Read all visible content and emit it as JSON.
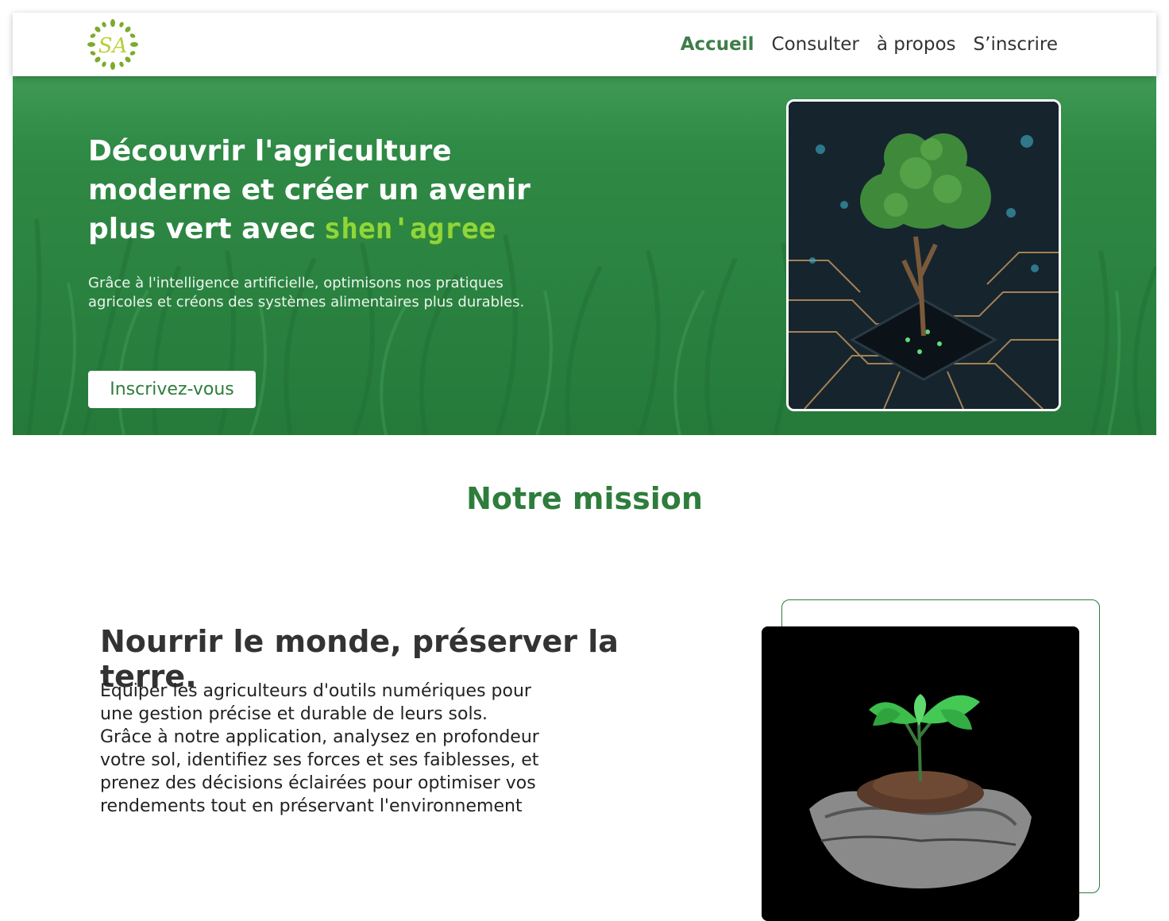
{
  "header": {
    "logo_text": "SA",
    "nav": [
      {
        "label": "Accueil",
        "active": true
      },
      {
        "label": "Consulter",
        "active": false
      },
      {
        "label": "à propos",
        "active": false
      },
      {
        "label": "S’inscrire",
        "active": false
      }
    ]
  },
  "hero": {
    "title": "Découvrir l'agriculture moderne et créer un avenir plus vert avec",
    "brand": "shen'agree",
    "subtitle": "Grâce à l'intelligence artificielle, optimisons nos pratiques agricoles et créons des systèmes alimentaires plus durables.",
    "cta_label": "Inscrivez-vous"
  },
  "mission": {
    "section_title": "Notre mission",
    "heading": "Nourrir le monde, préserver la terre.",
    "text": "Équiper les agriculteurs d'outils numériques pour une gestion précise et durable de leurs sols. Grâce à notre application, analysez en profondeur votre sol, identifiez ses forces et ses faiblesses, et prenez des décisions éclairées pour optimiser vos rendements tout en préservant l'environnement"
  },
  "colors": {
    "accent": "#2e7d3c",
    "nav_active": "#3f7d4a",
    "hero_bg": "#2f8a45",
    "brand_word": "#8fd63b"
  }
}
